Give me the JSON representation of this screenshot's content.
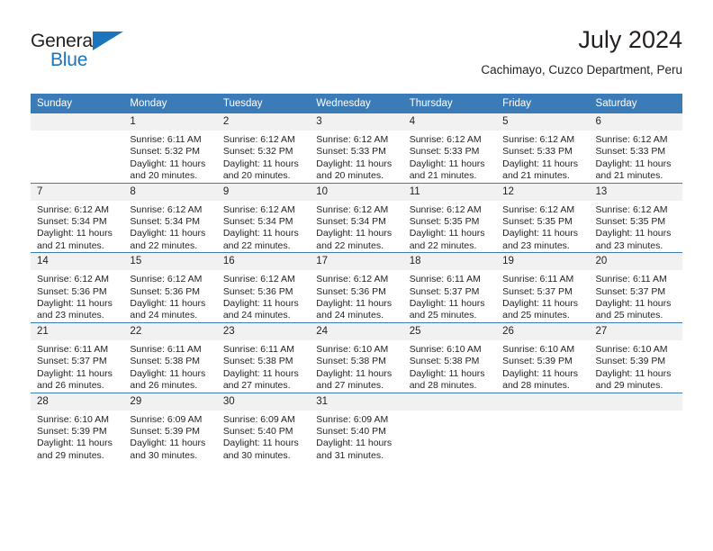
{
  "brand": {
    "name_part1": "General",
    "name_part2": "Blue",
    "accent_color": "#1c75bc"
  },
  "header": {
    "month_title": "July 2024",
    "location": "Cachimayo, Cuzco Department, Peru"
  },
  "theme": {
    "header_row_color": "#3b7cb8",
    "daynum_bg": "#f1f1f1",
    "text_color": "#231f20"
  },
  "calendar": {
    "weekday_headers": [
      "Sunday",
      "Monday",
      "Tuesday",
      "Wednesday",
      "Thursday",
      "Friday",
      "Saturday"
    ],
    "weeks": [
      [
        {
          "day": "",
          "empty": true,
          "sunrise": "",
          "sunset": "",
          "daylight_line1": "",
          "daylight_line2": ""
        },
        {
          "day": "1",
          "sunrise": "Sunrise: 6:11 AM",
          "sunset": "Sunset: 5:32 PM",
          "daylight_line1": "Daylight: 11 hours",
          "daylight_line2": "and 20 minutes."
        },
        {
          "day": "2",
          "sunrise": "Sunrise: 6:12 AM",
          "sunset": "Sunset: 5:32 PM",
          "daylight_line1": "Daylight: 11 hours",
          "daylight_line2": "and 20 minutes."
        },
        {
          "day": "3",
          "sunrise": "Sunrise: 6:12 AM",
          "sunset": "Sunset: 5:33 PM",
          "daylight_line1": "Daylight: 11 hours",
          "daylight_line2": "and 20 minutes."
        },
        {
          "day": "4",
          "sunrise": "Sunrise: 6:12 AM",
          "sunset": "Sunset: 5:33 PM",
          "daylight_line1": "Daylight: 11 hours",
          "daylight_line2": "and 21 minutes."
        },
        {
          "day": "5",
          "sunrise": "Sunrise: 6:12 AM",
          "sunset": "Sunset: 5:33 PM",
          "daylight_line1": "Daylight: 11 hours",
          "daylight_line2": "and 21 minutes."
        },
        {
          "day": "6",
          "sunrise": "Sunrise: 6:12 AM",
          "sunset": "Sunset: 5:33 PM",
          "daylight_line1": "Daylight: 11 hours",
          "daylight_line2": "and 21 minutes."
        }
      ],
      [
        {
          "day": "7",
          "sunrise": "Sunrise: 6:12 AM",
          "sunset": "Sunset: 5:34 PM",
          "daylight_line1": "Daylight: 11 hours",
          "daylight_line2": "and 21 minutes."
        },
        {
          "day": "8",
          "sunrise": "Sunrise: 6:12 AM",
          "sunset": "Sunset: 5:34 PM",
          "daylight_line1": "Daylight: 11 hours",
          "daylight_line2": "and 22 minutes."
        },
        {
          "day": "9",
          "sunrise": "Sunrise: 6:12 AM",
          "sunset": "Sunset: 5:34 PM",
          "daylight_line1": "Daylight: 11 hours",
          "daylight_line2": "and 22 minutes."
        },
        {
          "day": "10",
          "sunrise": "Sunrise: 6:12 AM",
          "sunset": "Sunset: 5:34 PM",
          "daylight_line1": "Daylight: 11 hours",
          "daylight_line2": "and 22 minutes."
        },
        {
          "day": "11",
          "sunrise": "Sunrise: 6:12 AM",
          "sunset": "Sunset: 5:35 PM",
          "daylight_line1": "Daylight: 11 hours",
          "daylight_line2": "and 22 minutes."
        },
        {
          "day": "12",
          "sunrise": "Sunrise: 6:12 AM",
          "sunset": "Sunset: 5:35 PM",
          "daylight_line1": "Daylight: 11 hours",
          "daylight_line2": "and 23 minutes."
        },
        {
          "day": "13",
          "sunrise": "Sunrise: 6:12 AM",
          "sunset": "Sunset: 5:35 PM",
          "daylight_line1": "Daylight: 11 hours",
          "daylight_line2": "and 23 minutes."
        }
      ],
      [
        {
          "day": "14",
          "sunrise": "Sunrise: 6:12 AM",
          "sunset": "Sunset: 5:36 PM",
          "daylight_line1": "Daylight: 11 hours",
          "daylight_line2": "and 23 minutes."
        },
        {
          "day": "15",
          "sunrise": "Sunrise: 6:12 AM",
          "sunset": "Sunset: 5:36 PM",
          "daylight_line1": "Daylight: 11 hours",
          "daylight_line2": "and 24 minutes."
        },
        {
          "day": "16",
          "sunrise": "Sunrise: 6:12 AM",
          "sunset": "Sunset: 5:36 PM",
          "daylight_line1": "Daylight: 11 hours",
          "daylight_line2": "and 24 minutes."
        },
        {
          "day": "17",
          "sunrise": "Sunrise: 6:12 AM",
          "sunset": "Sunset: 5:36 PM",
          "daylight_line1": "Daylight: 11 hours",
          "daylight_line2": "and 24 minutes."
        },
        {
          "day": "18",
          "sunrise": "Sunrise: 6:11 AM",
          "sunset": "Sunset: 5:37 PM",
          "daylight_line1": "Daylight: 11 hours",
          "daylight_line2": "and 25 minutes."
        },
        {
          "day": "19",
          "sunrise": "Sunrise: 6:11 AM",
          "sunset": "Sunset: 5:37 PM",
          "daylight_line1": "Daylight: 11 hours",
          "daylight_line2": "and 25 minutes."
        },
        {
          "day": "20",
          "sunrise": "Sunrise: 6:11 AM",
          "sunset": "Sunset: 5:37 PM",
          "daylight_line1": "Daylight: 11 hours",
          "daylight_line2": "and 25 minutes."
        }
      ],
      [
        {
          "day": "21",
          "sunrise": "Sunrise: 6:11 AM",
          "sunset": "Sunset: 5:37 PM",
          "daylight_line1": "Daylight: 11 hours",
          "daylight_line2": "and 26 minutes."
        },
        {
          "day": "22",
          "sunrise": "Sunrise: 6:11 AM",
          "sunset": "Sunset: 5:38 PM",
          "daylight_line1": "Daylight: 11 hours",
          "daylight_line2": "and 26 minutes."
        },
        {
          "day": "23",
          "sunrise": "Sunrise: 6:11 AM",
          "sunset": "Sunset: 5:38 PM",
          "daylight_line1": "Daylight: 11 hours",
          "daylight_line2": "and 27 minutes."
        },
        {
          "day": "24",
          "sunrise": "Sunrise: 6:10 AM",
          "sunset": "Sunset: 5:38 PM",
          "daylight_line1": "Daylight: 11 hours",
          "daylight_line2": "and 27 minutes."
        },
        {
          "day": "25",
          "sunrise": "Sunrise: 6:10 AM",
          "sunset": "Sunset: 5:38 PM",
          "daylight_line1": "Daylight: 11 hours",
          "daylight_line2": "and 28 minutes."
        },
        {
          "day": "26",
          "sunrise": "Sunrise: 6:10 AM",
          "sunset": "Sunset: 5:39 PM",
          "daylight_line1": "Daylight: 11 hours",
          "daylight_line2": "and 28 minutes."
        },
        {
          "day": "27",
          "sunrise": "Sunrise: 6:10 AM",
          "sunset": "Sunset: 5:39 PM",
          "daylight_line1": "Daylight: 11 hours",
          "daylight_line2": "and 29 minutes."
        }
      ],
      [
        {
          "day": "28",
          "sunrise": "Sunrise: 6:10 AM",
          "sunset": "Sunset: 5:39 PM",
          "daylight_line1": "Daylight: 11 hours",
          "daylight_line2": "and 29 minutes."
        },
        {
          "day": "29",
          "sunrise": "Sunrise: 6:09 AM",
          "sunset": "Sunset: 5:39 PM",
          "daylight_line1": "Daylight: 11 hours",
          "daylight_line2": "and 30 minutes."
        },
        {
          "day": "30",
          "sunrise": "Sunrise: 6:09 AM",
          "sunset": "Sunset: 5:40 PM",
          "daylight_line1": "Daylight: 11 hours",
          "daylight_line2": "and 30 minutes."
        },
        {
          "day": "31",
          "sunrise": "Sunrise: 6:09 AM",
          "sunset": "Sunset: 5:40 PM",
          "daylight_line1": "Daylight: 11 hours",
          "daylight_line2": "and 31 minutes."
        },
        {
          "day": "",
          "empty": true,
          "sunrise": "",
          "sunset": "",
          "daylight_line1": "",
          "daylight_line2": ""
        },
        {
          "day": "",
          "empty": true,
          "sunrise": "",
          "sunset": "",
          "daylight_line1": "",
          "daylight_line2": ""
        },
        {
          "day": "",
          "empty": true,
          "sunrise": "",
          "sunset": "",
          "daylight_line1": "",
          "daylight_line2": ""
        }
      ]
    ]
  }
}
